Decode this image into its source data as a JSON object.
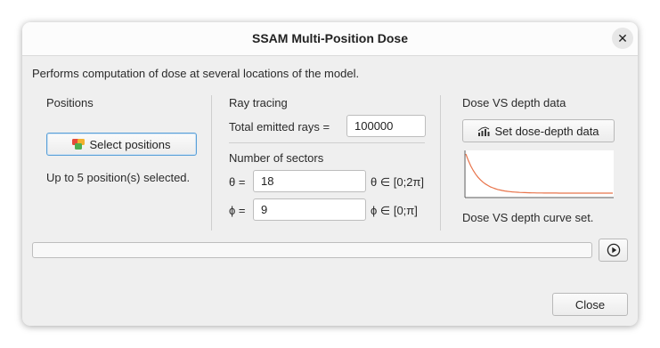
{
  "window": {
    "title": "SSAM Multi-Position Dose",
    "close_symbol": "✕"
  },
  "description": "Performs computation of dose at several locations of the model.",
  "positions": {
    "heading": "Positions",
    "select_button_label": "Select positions",
    "status": "Up to 5 position(s) selected."
  },
  "ray_tracing": {
    "heading": "Ray tracing",
    "rays_label": "Total emitted rays =",
    "rays_value": "100000",
    "sectors_heading": "Number of sectors",
    "theta_label": "θ =",
    "theta_value": "18",
    "theta_range": "θ ∈ [0;2π]",
    "phi_label": "ϕ =",
    "phi_value": "9",
    "phi_range": "ϕ ∈ [0;π]"
  },
  "dose_depth": {
    "heading": "Dose VS depth data",
    "set_button_label": "Set dose-depth data",
    "status": "Dose VS depth curve set.",
    "curve_color": "#e8734a"
  },
  "progress": {
    "fraction": 0
  },
  "footer": {
    "close_button_label": "Close"
  }
}
